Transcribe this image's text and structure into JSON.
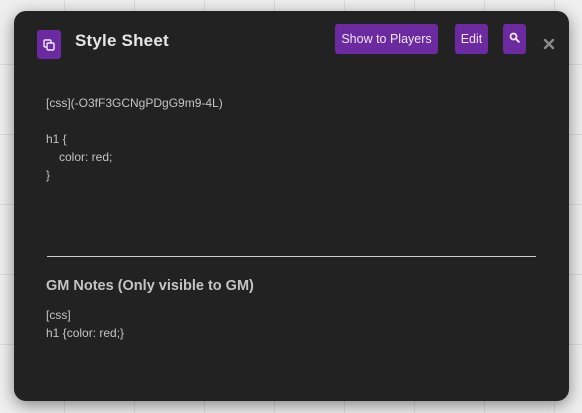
{
  "dialog": {
    "title": "Style Sheet",
    "title_icon": "copy-icon",
    "buttons": {
      "show_to_players": "Show to Players",
      "edit": "Edit",
      "search_icon": "search-icon"
    },
    "close_icon": "close-icon"
  },
  "content": {
    "lines": [
      "[css](-O3fF3GCNgPDgG9m9-4L)",
      "",
      "h1 {",
      "color: red;",
      "}"
    ]
  },
  "gm": {
    "heading": "GM Notes (Only visible to GM)",
    "lines": [
      "[css]",
      "h1 {color: red;}"
    ]
  },
  "colors": {
    "dialog_bg": "#222222",
    "accent": "#6b2aa0",
    "text": "#c4c4c4",
    "page_bg": "#efefef"
  }
}
